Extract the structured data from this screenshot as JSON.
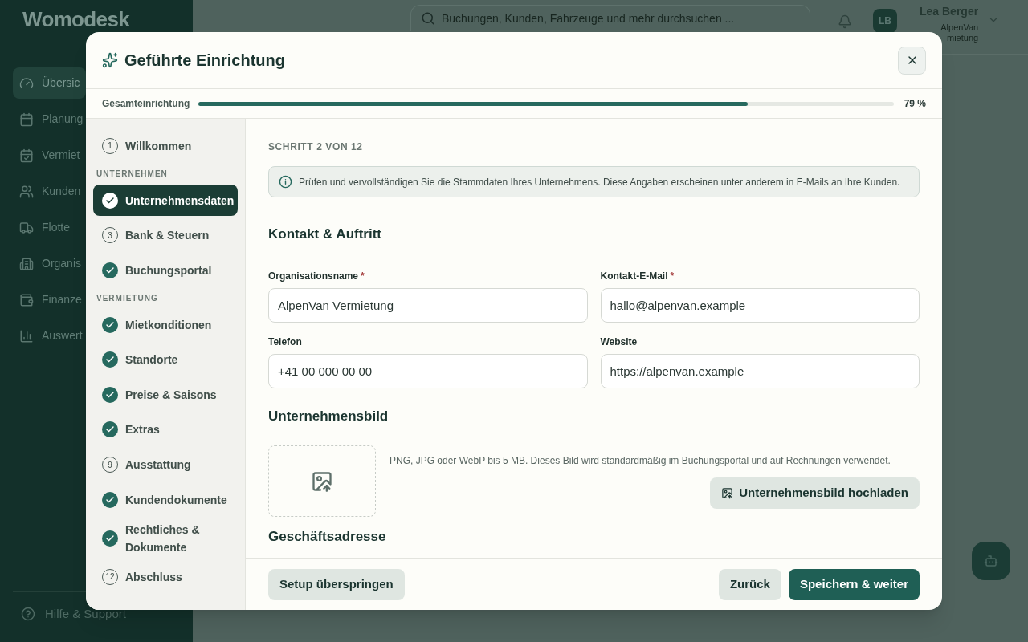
{
  "app": {
    "logo": "Womodesk",
    "nav": [
      {
        "label": "Übersic",
        "selected": true
      },
      {
        "label": "Planung",
        "selected": false
      },
      {
        "label": "Vermiet",
        "selected": false
      },
      {
        "label": "Kunden",
        "selected": false
      },
      {
        "label": "Flotte",
        "selected": false
      },
      {
        "label": "Organis",
        "selected": false
      },
      {
        "label": "Finanze",
        "selected": false
      },
      {
        "label": "Auswert",
        "selected": false
      }
    ],
    "help": "Hilfe & Support",
    "search": {
      "placeholder": "Buchungen, Kunden, Fahrzeuge und mehr durchsuchen ..."
    },
    "user": {
      "initials": "LB",
      "name": "Lea Berger",
      "org_line_1": "AlpenVan",
      "org_line_2": "mietung"
    }
  },
  "dialog": {
    "title": "Geführte Einrichtung",
    "progress": {
      "label": "Gesamteinrichtung",
      "level": 0.79,
      "reading": "79 %"
    },
    "steps": [
      {
        "items": [
          {
            "label": "Willkommen",
            "number": "1",
            "completed": false,
            "selected": false
          }
        ]
      },
      {
        "heading": "UNTERNEHMEN",
        "items": [
          {
            "label": "Unternehmensdaten",
            "completed": true,
            "selected": true
          },
          {
            "label": "Bank & Steuern",
            "number": "3",
            "completed": false,
            "selected": false
          },
          {
            "label": "Buchungsportal",
            "completed": true,
            "selected": false
          }
        ]
      },
      {
        "heading": "VERMIETUNG",
        "items": [
          {
            "label": "Mietkonditionen",
            "completed": true,
            "selected": false
          },
          {
            "label": "Standorte",
            "completed": true,
            "selected": false
          },
          {
            "label": "Preise & Saisons",
            "completed": true,
            "selected": false
          },
          {
            "label": "Extras",
            "completed": true,
            "selected": false
          },
          {
            "label": "Ausstattung",
            "number": "9",
            "completed": false,
            "selected": false
          },
          {
            "label": "Kundendokumente",
            "completed": true,
            "selected": false
          },
          {
            "label": "Rechtliches & Dokumente",
            "completed": true,
            "selected": false
          },
          {
            "label": "Abschluss",
            "number": "12",
            "completed": false,
            "selected": false
          }
        ]
      }
    ],
    "step_caption": "SCHRITT 2 VON 12",
    "info": "Prüfen und vervollständigen Sie die Stammdaten Ihres Unternehmens. Diese Angaben erscheinen unter anderem in E-Mails an Ihre Kunden.",
    "contact": {
      "heading": "Kontakt & Auftritt",
      "required_mark": "*",
      "fields": [
        {
          "label": "Organisationsname",
          "required": true,
          "value": "AlpenVan Vermietung"
        },
        {
          "label": "Kontakt-E-Mail",
          "required": true,
          "value": "hallo@alpenvan.example"
        },
        {
          "label": "Telefon",
          "required": false,
          "value": "+41 00 000 00 00"
        },
        {
          "label": "Website",
          "required": false,
          "value": "https://alpenvan.example"
        }
      ]
    },
    "image": {
      "heading": "Unternehmensbild",
      "hint": "PNG, JPG oder WebP bis 5 MB. Dieses Bild wird standardmäßig im Buchungsportal und auf Rechnungen verwendet.",
      "upload_button": "Unternehmensbild hochladen"
    },
    "next_heading": "Geschäftsadresse",
    "footer": {
      "skip": "Setup überspringen",
      "back": "Zurück",
      "next": "Speichern & weiter"
    }
  }
}
